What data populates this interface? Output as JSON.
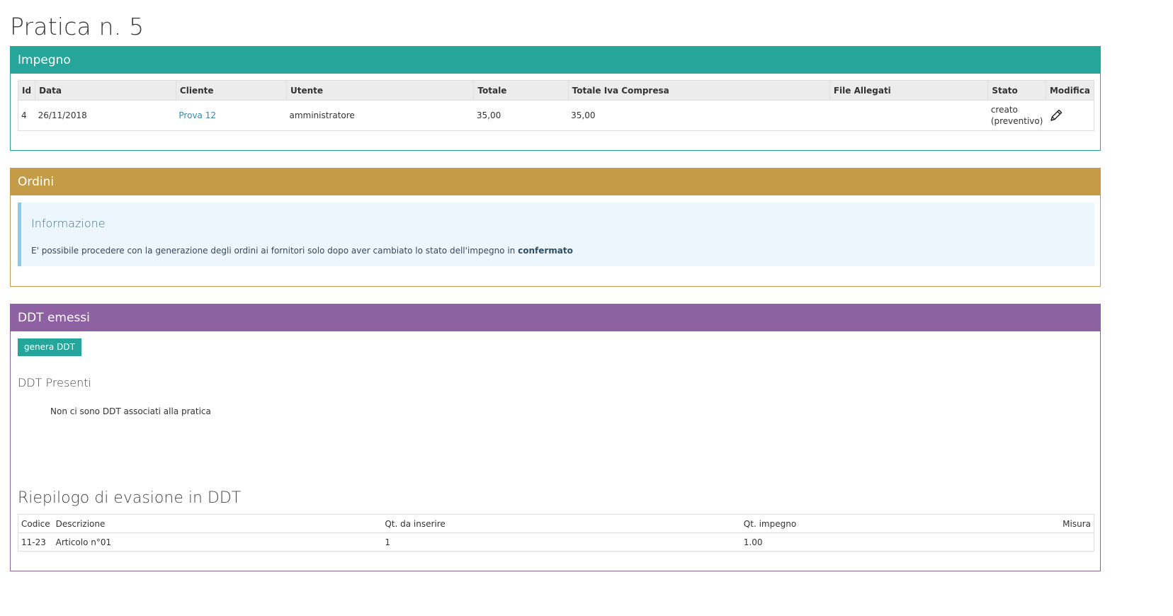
{
  "page": {
    "title": "Pratica n. 5"
  },
  "impegno": {
    "heading": "Impegno",
    "color": "#26a69a",
    "columns": [
      "Id",
      "Data",
      "Cliente",
      "Utente",
      "Totale",
      "Totale Iva Compresa",
      "File Allegati",
      "Stato",
      "Modifica"
    ],
    "row": {
      "id": "4",
      "data": "26/11/2018",
      "cliente": "Prova 12",
      "utente": "amministratore",
      "totale": "35,00",
      "totale_iva": "35,00",
      "file_allegati": "",
      "stato_line1": "creato",
      "stato_line2": "(preventivo)",
      "modifica_icon": "pencil-icon"
    }
  },
  "ordini": {
    "heading": "Ordini",
    "color": "#c49c48",
    "info_title": "Informazione",
    "info_text": "E' possibile procedere con la generazione degli ordini ai fornitori solo dopo aver cambiato lo stato dell'impegno in ",
    "info_bold": "confermato"
  },
  "ddt": {
    "heading": "DDT emessi",
    "color": "#8e61a3",
    "button_label": "genera DDT",
    "presenti_title": "DDT Presenti",
    "empty_message": "Non ci sono DDT associati alla pratica",
    "riepilogo_title": "Riepilogo di evasione in DDT",
    "riepilogo_columns": [
      "Codice",
      "Descrizione",
      "Qt. da inserire",
      "Qt. impegno",
      "Misura"
    ],
    "riepilogo_rows": [
      {
        "codice": "11-23",
        "descrizione": "Articolo n°01",
        "qt_inserire": "1",
        "qt_impegno": "1.00",
        "misura": ""
      }
    ]
  }
}
